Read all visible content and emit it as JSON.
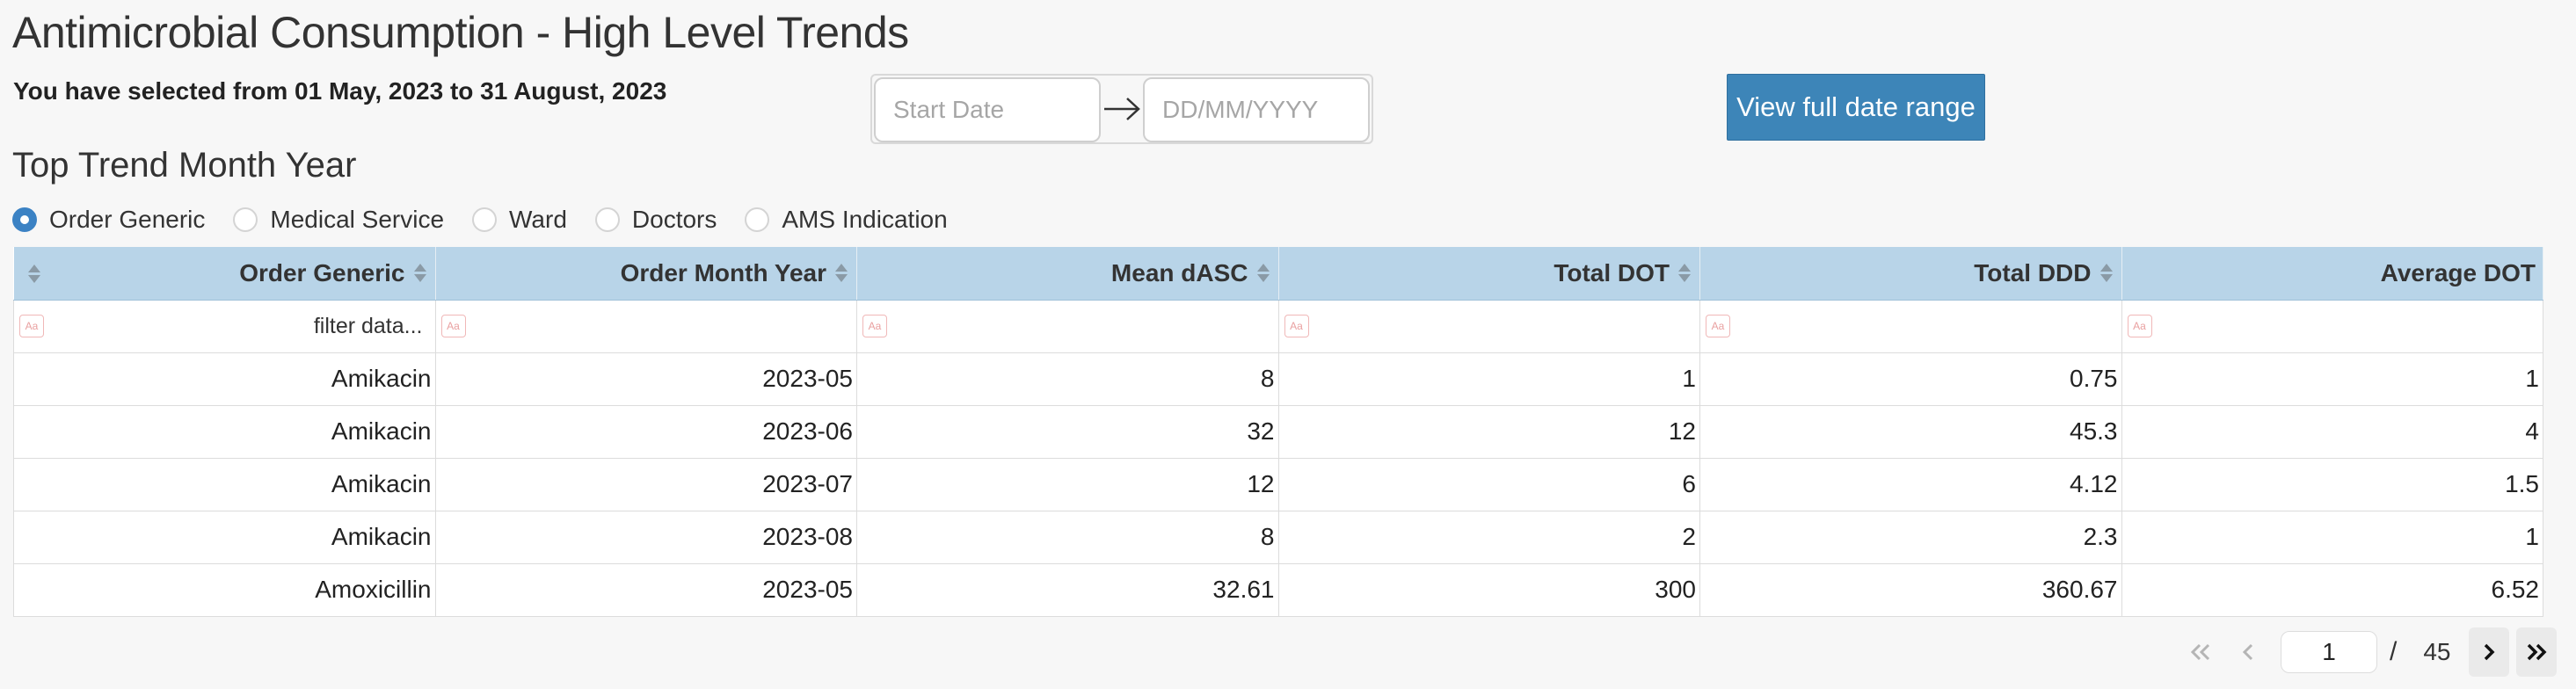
{
  "header": {
    "title": "Antimicrobial Consumption - High Level Trends",
    "selection_text": "You have selected from 01 May, 2023 to 31 August, 2023"
  },
  "date_range": {
    "start_placeholder": "Start Date",
    "end_placeholder": "DD/MM/YYYY",
    "full_range_label": "View full date range"
  },
  "section": {
    "title": "Top Trend Month Year"
  },
  "radio_options": [
    {
      "label": "Order Generic",
      "checked": true
    },
    {
      "label": "Medical Service",
      "checked": false
    },
    {
      "label": "Ward",
      "checked": false
    },
    {
      "label": "Doctors",
      "checked": false
    },
    {
      "label": "AMS Indication",
      "checked": false
    }
  ],
  "table": {
    "columns": [
      "Order Generic",
      "Order Month Year",
      "Mean dASC",
      "Total DOT",
      "Total DDD",
      "Average DOT"
    ],
    "filter_placeholder": "filter data...",
    "case_toggle_label": "Aa",
    "rows": [
      [
        "Amikacin",
        "2023-05",
        "8",
        "1",
        "0.75",
        "1"
      ],
      [
        "Amikacin",
        "2023-06",
        "32",
        "12",
        "45.3",
        "4"
      ],
      [
        "Amikacin",
        "2023-07",
        "12",
        "6",
        "4.12",
        "1.5"
      ],
      [
        "Amikacin",
        "2023-08",
        "8",
        "2",
        "2.3",
        "1"
      ],
      [
        "Amoxicillin",
        "2023-05",
        "32.61",
        "300",
        "360.67",
        "6.52"
      ]
    ]
  },
  "pagination": {
    "current_page": "1",
    "separator": "/",
    "total_pages": "45"
  },
  "colors": {
    "accent": "#3d85b8",
    "table_header": "#b8d4e8",
    "radio_checked": "#3b82c4"
  }
}
